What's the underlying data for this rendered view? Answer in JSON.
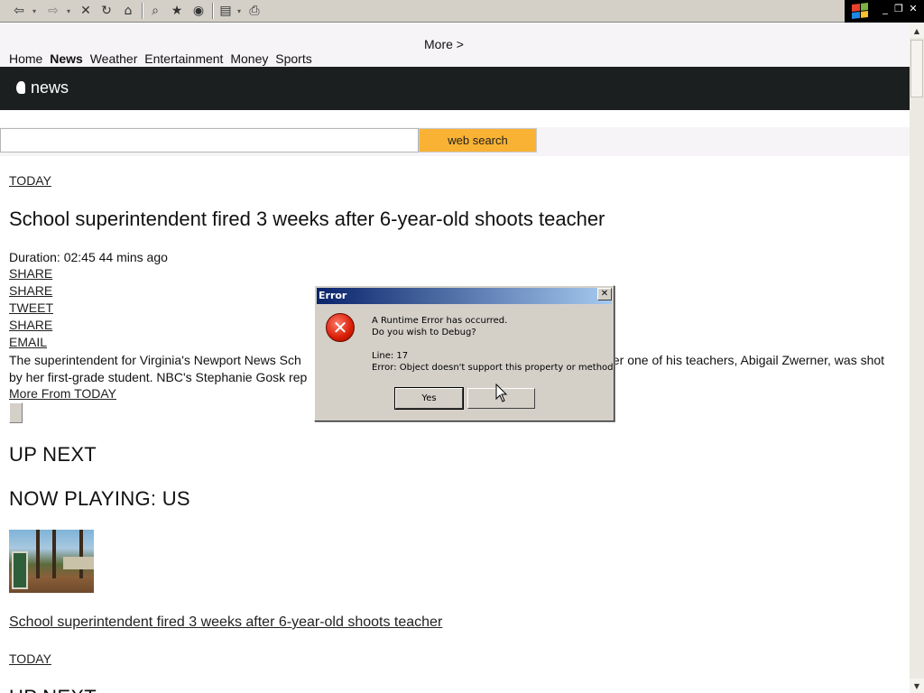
{
  "toolbar": {
    "icons": [
      "back-icon",
      "forward-icon",
      "stop-icon",
      "refresh-icon",
      "home-icon",
      "search-icon",
      "favorites-icon",
      "media-icon",
      "edit-icon",
      "print-icon"
    ],
    "back_glyph": "⇦",
    "forward_glyph": "⇨",
    "stop_glyph": "✕",
    "refresh_glyph": "↻",
    "home_glyph": "⌂",
    "search_glyph": "⌕",
    "favorites_glyph": "★",
    "media_glyph": "◉",
    "edit_glyph": "▤",
    "print_glyph": "⎙",
    "minimize_glyph": "_",
    "restore_glyph": "❐",
    "close_glyph": "✕"
  },
  "nav": {
    "more_label": "More >",
    "links": [
      "Home",
      "News",
      "Weather",
      "Entertainment",
      "Money",
      "Sports"
    ],
    "active": "News"
  },
  "brand": {
    "label": "news"
  },
  "search": {
    "value": "",
    "button_label": "web search"
  },
  "article": {
    "show": "TODAY",
    "headline": "School superintendent fired 3 weeks after 6-year-old shoots teacher",
    "meta": "Duration: 02:45 44 mins ago",
    "actions": [
      "SHARE",
      "SHARE",
      "TWEET",
      "SHARE",
      "EMAIL"
    ],
    "summary": "The superintendent for Virginia's Newport News Sch",
    "summary_cont": "ter one of his teachers, Abigail Zwerner, was shot",
    "summary_line2": "by her first-grade student. NBC's Stephanie Gosk rep",
    "more_link": "More From TODAY"
  },
  "sections": {
    "up_next": "UP NEXT",
    "now_playing": "NOW PLAYING: US",
    "item_title": "School superintendent fired 3 weeks after 6-year-old shoots teacher",
    "item_show": "TODAY",
    "cutoff_heading": "UP NEXT"
  },
  "dialog": {
    "title": "Error",
    "line1": "A Runtime Error has occurred.",
    "line2": "Do you wish to Debug?",
    "line3": "Line: 17",
    "line4": "Error: Object doesn't support this property or method",
    "yes_label": "Yes",
    "no_label": "",
    "close_glyph": "✕",
    "icon_glyph": "✕"
  },
  "colors": {
    "brand_bar": "#1b1f1f",
    "search_button": "#f9b233",
    "dialog_title_start": "#0a246a",
    "dialog_title_end": "#a6caf0",
    "error_icon": "#d81e05"
  }
}
